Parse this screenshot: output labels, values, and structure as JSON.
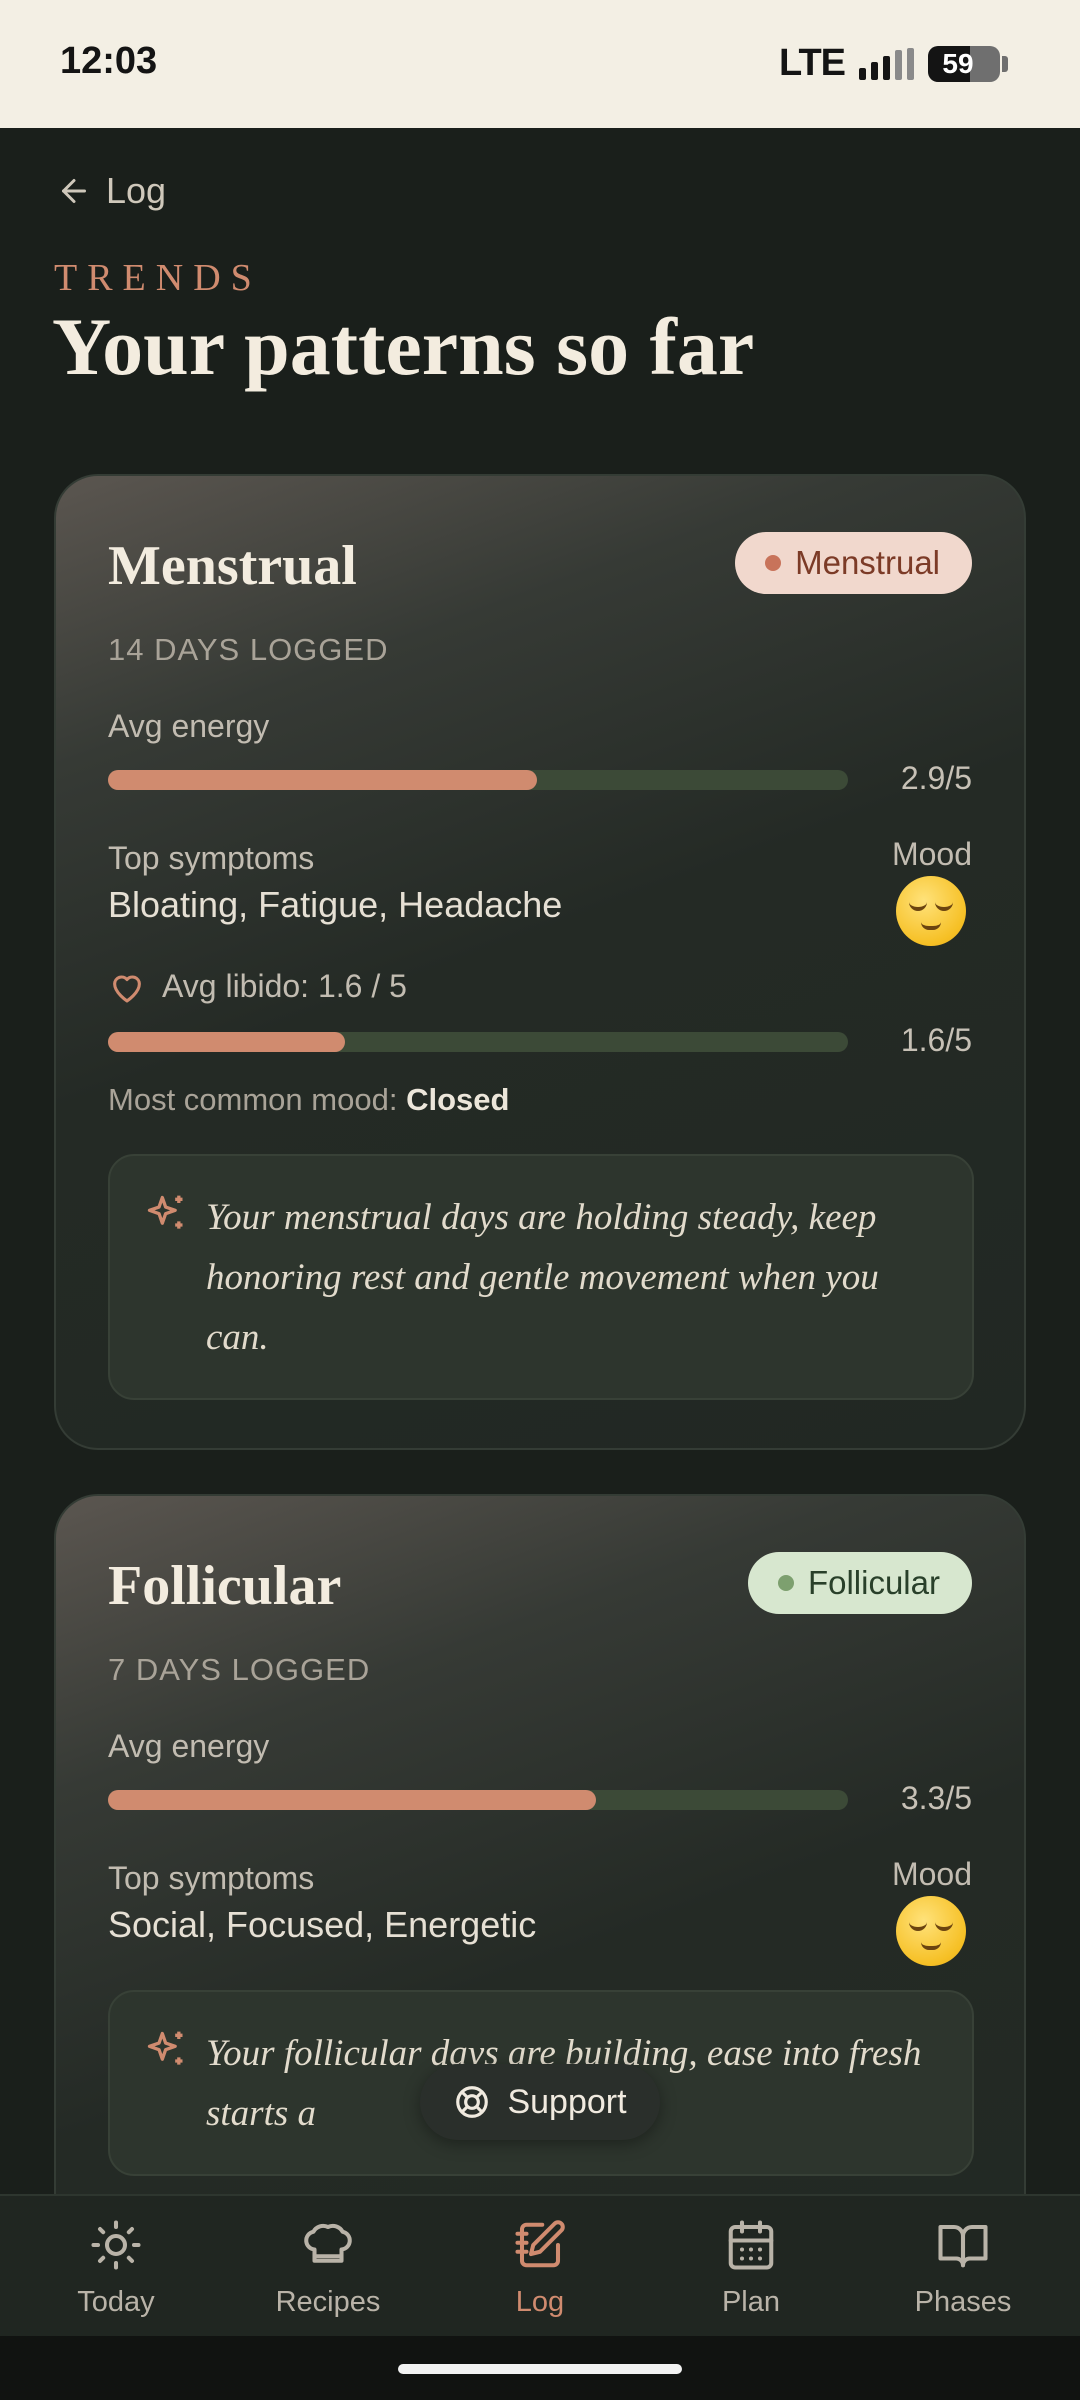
{
  "status_bar": {
    "time": "12:03",
    "network": "LTE",
    "battery": "59"
  },
  "header": {
    "back_label": "Log",
    "eyebrow": "TRENDS",
    "title": "Your patterns so far"
  },
  "phases": [
    {
      "title": "Menstrual",
      "badge": "Menstrual",
      "days_logged": "14 DAYS LOGGED",
      "energy_label": "Avg energy",
      "energy_score": "2.9/5",
      "energy_value": 2.9,
      "symptoms_label": "Top symptoms",
      "symptoms": "Bloating, Fatigue, Headache",
      "mood_label": "Mood",
      "mood_icon": "relieved-face-emoji",
      "libido_label": "Avg libido: 1.6 / 5",
      "libido_score": "1.6/5",
      "libido_value": 1.6,
      "common_mood_label": "Most common mood:",
      "common_mood": "Closed",
      "insight": "Your menstrual days are holding steady, keep honoring rest and gentle movement when you can."
    },
    {
      "title": "Follicular",
      "badge": "Follicular",
      "days_logged": "7 DAYS LOGGED",
      "energy_label": "Avg energy",
      "energy_score": "3.3/5",
      "energy_value": 3.3,
      "symptoms_label": "Top symptoms",
      "symptoms": "Social, Focused, Energetic",
      "mood_label": "Mood",
      "mood_icon": "relieved-face-emoji",
      "insight": "Your follicular days are building, ease into fresh starts a"
    }
  ],
  "support_label": "Support",
  "bottom_nav": [
    {
      "label": "Today",
      "icon": "sun-icon"
    },
    {
      "label": "Recipes",
      "icon": "chef-hat-icon"
    },
    {
      "label": "Log",
      "icon": "notebook-pen-icon",
      "active": true
    },
    {
      "label": "Plan",
      "icon": "calendar-icon"
    },
    {
      "label": "Phases",
      "icon": "open-book-icon"
    }
  ],
  "colors": {
    "accent": "#d08b6f",
    "background": "#1a1f1b",
    "menstrual_badge": "#f1d8cd",
    "follicular_badge": "#d7e7cf"
  }
}
